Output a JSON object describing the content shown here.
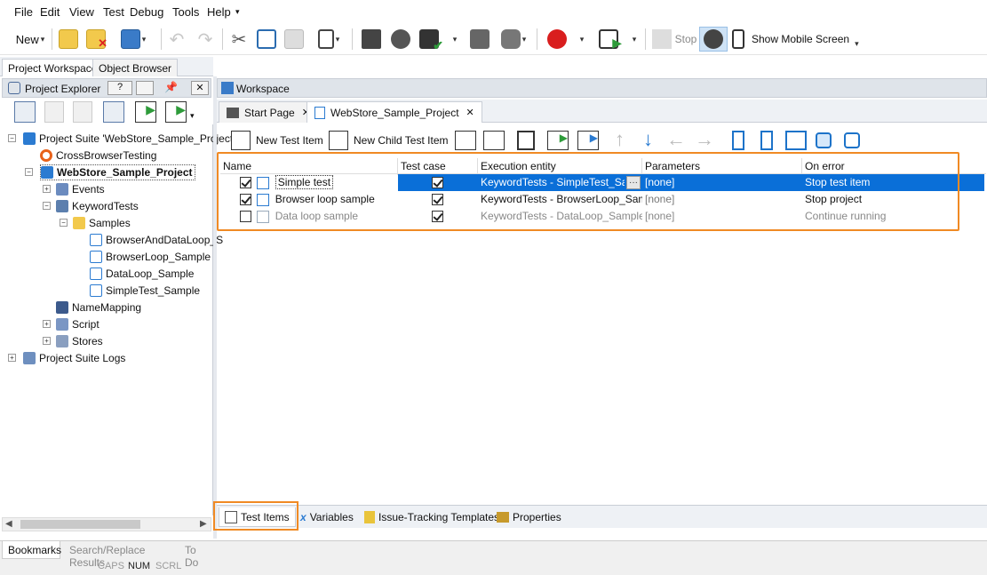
{
  "menu": [
    "File",
    "Edit",
    "View",
    "Test",
    "Debug",
    "Tools",
    "Help"
  ],
  "toolbar": {
    "new_label": "New",
    "stop_label": "Stop",
    "mobile_label": "Show Mobile Screen"
  },
  "left_tabs": [
    "Project Workspace",
    "Object Browser"
  ],
  "project_explorer": {
    "title": "Project Explorer",
    "help": "?"
  },
  "tree": [
    {
      "label": "Project Suite 'WebStore_Sample_Project"
    },
    {
      "label": "CrossBrowserTesting"
    },
    {
      "label": "WebStore_Sample_Project"
    },
    {
      "label": "Events"
    },
    {
      "label": "KeywordTests"
    },
    {
      "label": "Samples"
    },
    {
      "label": "BrowserAndDataLoop_S"
    },
    {
      "label": "BrowserLoop_Sample"
    },
    {
      "label": "DataLoop_Sample"
    },
    {
      "label": "SimpleTest_Sample"
    },
    {
      "label": "NameMapping"
    },
    {
      "label": "Script"
    },
    {
      "label": "Stores"
    },
    {
      "label": "Project Suite Logs"
    }
  ],
  "workspace": {
    "title": "Workspace",
    "tabs": [
      "Start Page",
      "WebStore_Sample_Project"
    ],
    "tab_close": "✕"
  },
  "test_toolbar": {
    "new_test_item": "New Test Item",
    "new_child_test_item": "New Child Test Item"
  },
  "grid": {
    "headers": [
      "Name",
      "Test case",
      "Execution entity",
      "Parameters",
      "On error"
    ],
    "rows": [
      {
        "name": "Simple test",
        "enabled": true,
        "test_case": true,
        "entity": "KeywordTests - SimpleTest_Sa...",
        "ellipsis": "···",
        "params": "[none]",
        "on_error": "Stop test item",
        "selected": true
      },
      {
        "name": "Browser loop sample",
        "enabled": true,
        "test_case": true,
        "entity": "KeywordTests - BrowserLoop_Sample",
        "params": "[none]",
        "on_error": "Stop project",
        "selected": false
      },
      {
        "name": "Data loop sample",
        "enabled": false,
        "test_case": true,
        "entity": "KeywordTests - DataLoop_Sample",
        "params": "[none]",
        "on_error": "Continue running",
        "selected": false
      }
    ]
  },
  "bottom_tabs": [
    "Test Items",
    "Variables",
    "Issue-Tracking Templates",
    "Properties"
  ],
  "status_tabs": [
    "Bookmarks",
    "Search/Replace Results",
    "To Do"
  ],
  "status_indicators": [
    "CAPS",
    "NUM",
    "SCRL"
  ],
  "colors": {
    "selection": "#0a6fd8",
    "highlight": "#f08a24",
    "panel_head": "#dfe4ea"
  }
}
